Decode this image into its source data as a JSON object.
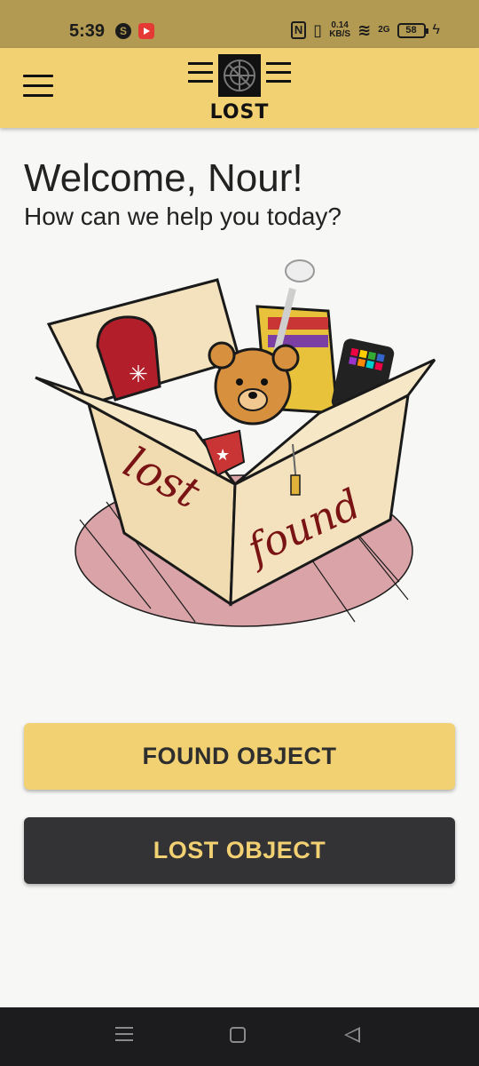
{
  "status_bar": {
    "time": "5:39",
    "nfc": "N",
    "net_speed_value": "0.14",
    "net_speed_unit": "KB/S",
    "network_type": "2G",
    "battery_level": "58",
    "colors": {
      "background": "#b29a52"
    }
  },
  "header": {
    "logo_text": "LOST",
    "background": "#f2d173"
  },
  "welcome": {
    "title": "Welcome, Nour!",
    "subtitle": "How can we help you today?"
  },
  "illustration": {
    "box_word_1": "lost",
    "box_word_2": "found"
  },
  "actions": {
    "found_label": "FOUND OBJECT",
    "lost_label": "LOST OBJECT",
    "found_color": "#f2d173",
    "lost_color": "#333335"
  },
  "nav_bar": {
    "icons": [
      "menu-icon",
      "home-icon",
      "back-icon"
    ]
  }
}
